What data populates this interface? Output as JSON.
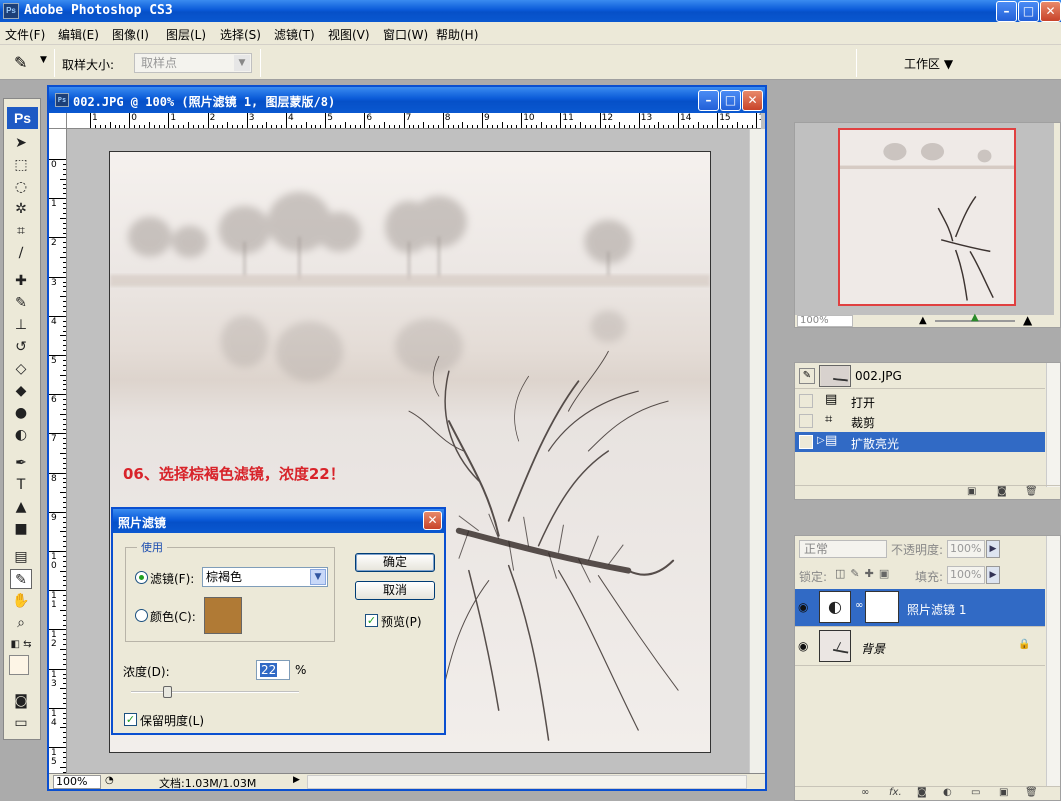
{
  "app": {
    "title": "Adobe Photoshop CS3",
    "logo": "Ps"
  },
  "menu": [
    "文件(F)",
    "编辑(E)",
    "图像(I)",
    "图层(L)",
    "选择(S)",
    "滤镜(T)",
    "视图(V)",
    "窗口(W)",
    "帮助(H)"
  ],
  "options": {
    "sample_size_label": "取样大小:",
    "sample_size_value": "取样点",
    "workspace_label": "工作区 ▼",
    "tool_icon": "eyedropper-icon"
  },
  "document": {
    "title": "002.JPG @ 100% (照片滤镜 1, 图层蒙版/8)",
    "zoom": "100%",
    "doc_info": "文档:1.03M/1.03M",
    "ruler_h": [
      "1",
      "0",
      "1",
      "2",
      "3",
      "4",
      "5",
      "6",
      "7",
      "8",
      "9",
      "10",
      "11",
      "12",
      "13",
      "14",
      "15",
      "16"
    ],
    "ruler_v": [
      "0",
      "1",
      "2",
      "3",
      "4",
      "5",
      "6",
      "7",
      "8",
      "9",
      "1\n0",
      "1\n1",
      "1\n2",
      "1\n3",
      "1\n4",
      "1\n5"
    ]
  },
  "annotation": "06、选择棕褐色滤镜，浓度22！",
  "photo_filter_dialog": {
    "title": "照片滤镜",
    "use_group": "使用",
    "filter_label": "滤镜(F):",
    "filter_value": "棕褐色",
    "color_label": "颜色(C):",
    "color_value": "#b07a35",
    "ok_label": "确定",
    "cancel_label": "取消",
    "preview_label": "预览(P)",
    "density_label": "浓度(D):",
    "density_value": "22",
    "density_unit": "%",
    "density_fraction": 0.22,
    "preserve_label": "保留明度(L)"
  },
  "navigator": {
    "zoom": "100%"
  },
  "history": {
    "snapshot": "002.JPG",
    "items": [
      {
        "label": "打开",
        "icon": "document-icon"
      },
      {
        "label": "裁剪",
        "icon": "crop-icon"
      },
      {
        "label": "扩散亮光",
        "icon": "document-icon"
      }
    ]
  },
  "layers": {
    "blend_mode": "正常",
    "opacity_label": "不透明度:",
    "opacity_value": "100%",
    "lock_label": "锁定:",
    "fill_label": "填充:",
    "fill_value": "100%",
    "items": [
      {
        "name": "照片滤镜 1"
      },
      {
        "name": "背景"
      }
    ]
  }
}
